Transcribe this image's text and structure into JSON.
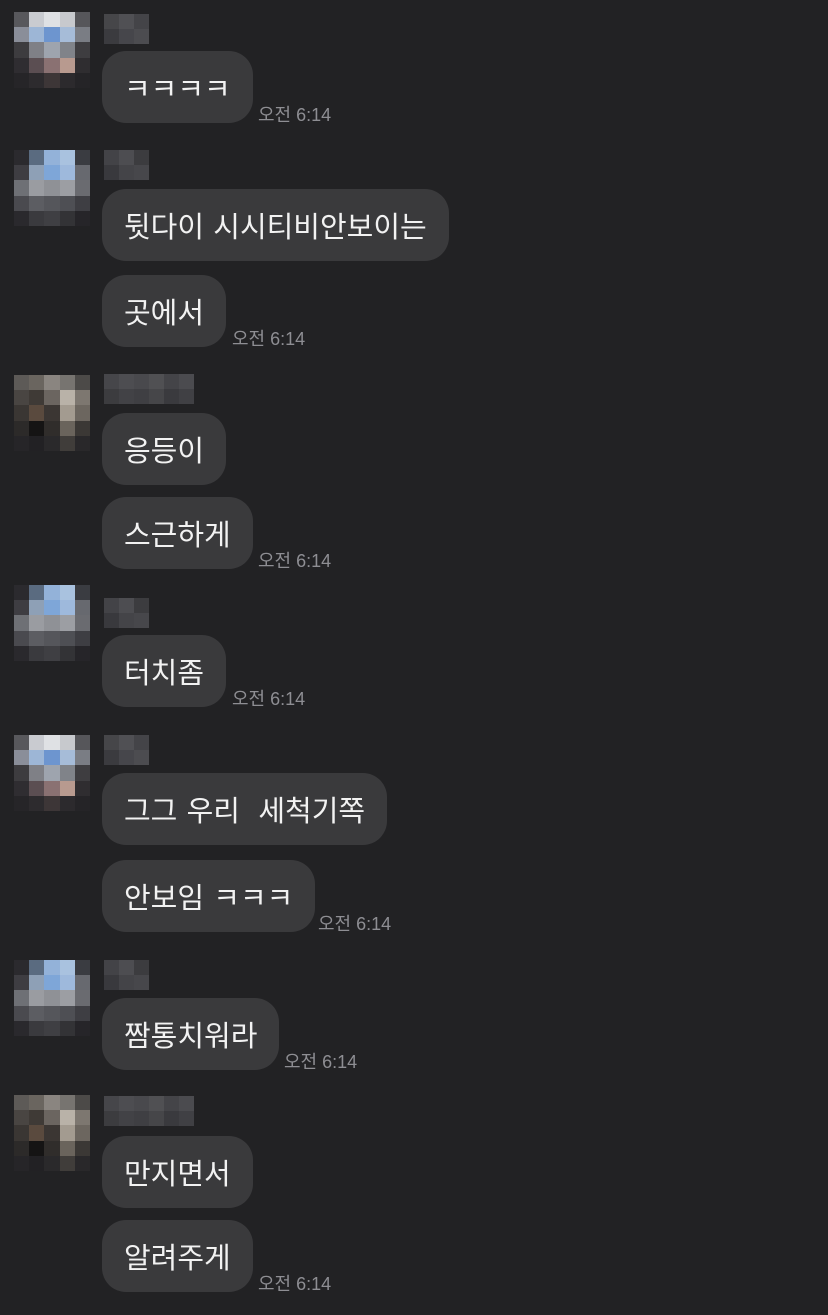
{
  "messages": [
    {
      "text": "ㅋㅋㅋㅋ",
      "time": "오전 6:14"
    },
    {
      "text": "뒷다이 시시티비안보이는"
    },
    {
      "text": "곳에서",
      "time": "오전 6:14"
    },
    {
      "text": "응등이"
    },
    {
      "text": "스근하게",
      "time": "오전 6:14"
    },
    {
      "text": "터치좀",
      "time": "오전 6:14"
    },
    {
      "text": "그그 우리  세척기쪽"
    },
    {
      "text": "안보임 ㅋㅋㅋ",
      "time": "오전 6:14"
    },
    {
      "text": "짬통치워라",
      "time": "오전 6:14"
    },
    {
      "text": "만지면서"
    },
    {
      "text": "알려주게",
      "time": "오전 6:14"
    }
  ]
}
